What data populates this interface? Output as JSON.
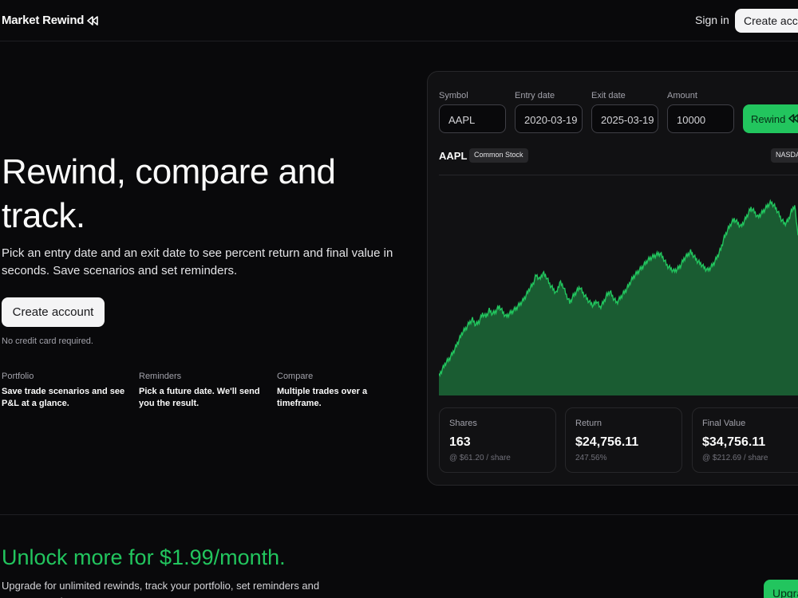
{
  "header": {
    "brand": "Market Rewind",
    "sign_in": "Sign in",
    "create_account": "Create account"
  },
  "hero": {
    "title": "Rewind, compare and track.",
    "subtitle": "Pick an entry date and an exit date to see percent return and final value in seconds. Save scenarios and set reminders.",
    "cta": "Create account",
    "note": "No credit card required."
  },
  "features": [
    {
      "title": "Portfolio",
      "desc": "Save trade scenarios and see P&L at a glance."
    },
    {
      "title": "Reminders",
      "desc": "Pick a future date. We'll send you the result."
    },
    {
      "title": "Compare",
      "desc": "Multiple trades over a timeframe."
    }
  ],
  "form": {
    "symbol_label": "Symbol",
    "symbol_value": "AAPL",
    "entry_label": "Entry date",
    "entry_value": "2020-03-19",
    "exit_label": "Exit date",
    "exit_value": "2025-03-19",
    "amount_label": "Amount",
    "amount_value": "10000",
    "rewind_button": "Rewind"
  },
  "symbol_header": {
    "symbol": "AAPL",
    "type_badge": "Common Stock",
    "exchange": "NASDAQ"
  },
  "chart_data": {
    "type": "area",
    "color": "#22c55e",
    "fill": "#1a5c32",
    "x_start": "2020-03-19",
    "x_end": "2025-03-19",
    "values": [
      61.2,
      68,
      75,
      79,
      85,
      92,
      100,
      108,
      112,
      118,
      122,
      116,
      120,
      128,
      125,
      132,
      128,
      131,
      136,
      130,
      125,
      128,
      131,
      134,
      138,
      142,
      148,
      155,
      160,
      170,
      165,
      172,
      168,
      160,
      155,
      150,
      162,
      158,
      148,
      140,
      147,
      152,
      157,
      150,
      145,
      140,
      137,
      142,
      135,
      140,
      148,
      152,
      145,
      140,
      145,
      150,
      155,
      162,
      168,
      172,
      176,
      180,
      185,
      188,
      190,
      192,
      193,
      187,
      180,
      177,
      174,
      176,
      180,
      187,
      191,
      195,
      190,
      185,
      182,
      178,
      175,
      178,
      183,
      190,
      198,
      210,
      218,
      225,
      230,
      226,
      222,
      228,
      235,
      242,
      238,
      232,
      236,
      240,
      245,
      248,
      244,
      238,
      230,
      225,
      228,
      238,
      245,
      212.69
    ]
  },
  "stats": [
    {
      "label": "Shares",
      "value": "163",
      "sub": "@ $61.20 / share"
    },
    {
      "label": "Return",
      "value": "$24,756.11",
      "sub": "247.56%"
    },
    {
      "label": "Final Value",
      "value": "$34,756.11",
      "sub": "@ $212.69 / share"
    }
  ],
  "upsell": {
    "title": "Unlock more for $1.99/month.",
    "text": "Upgrade for unlimited rewinds, track your portfolio, set reminders and compare trades.",
    "button": "Upgrade"
  },
  "colors": {
    "accent": "#22c55e",
    "background": "#09090b"
  }
}
